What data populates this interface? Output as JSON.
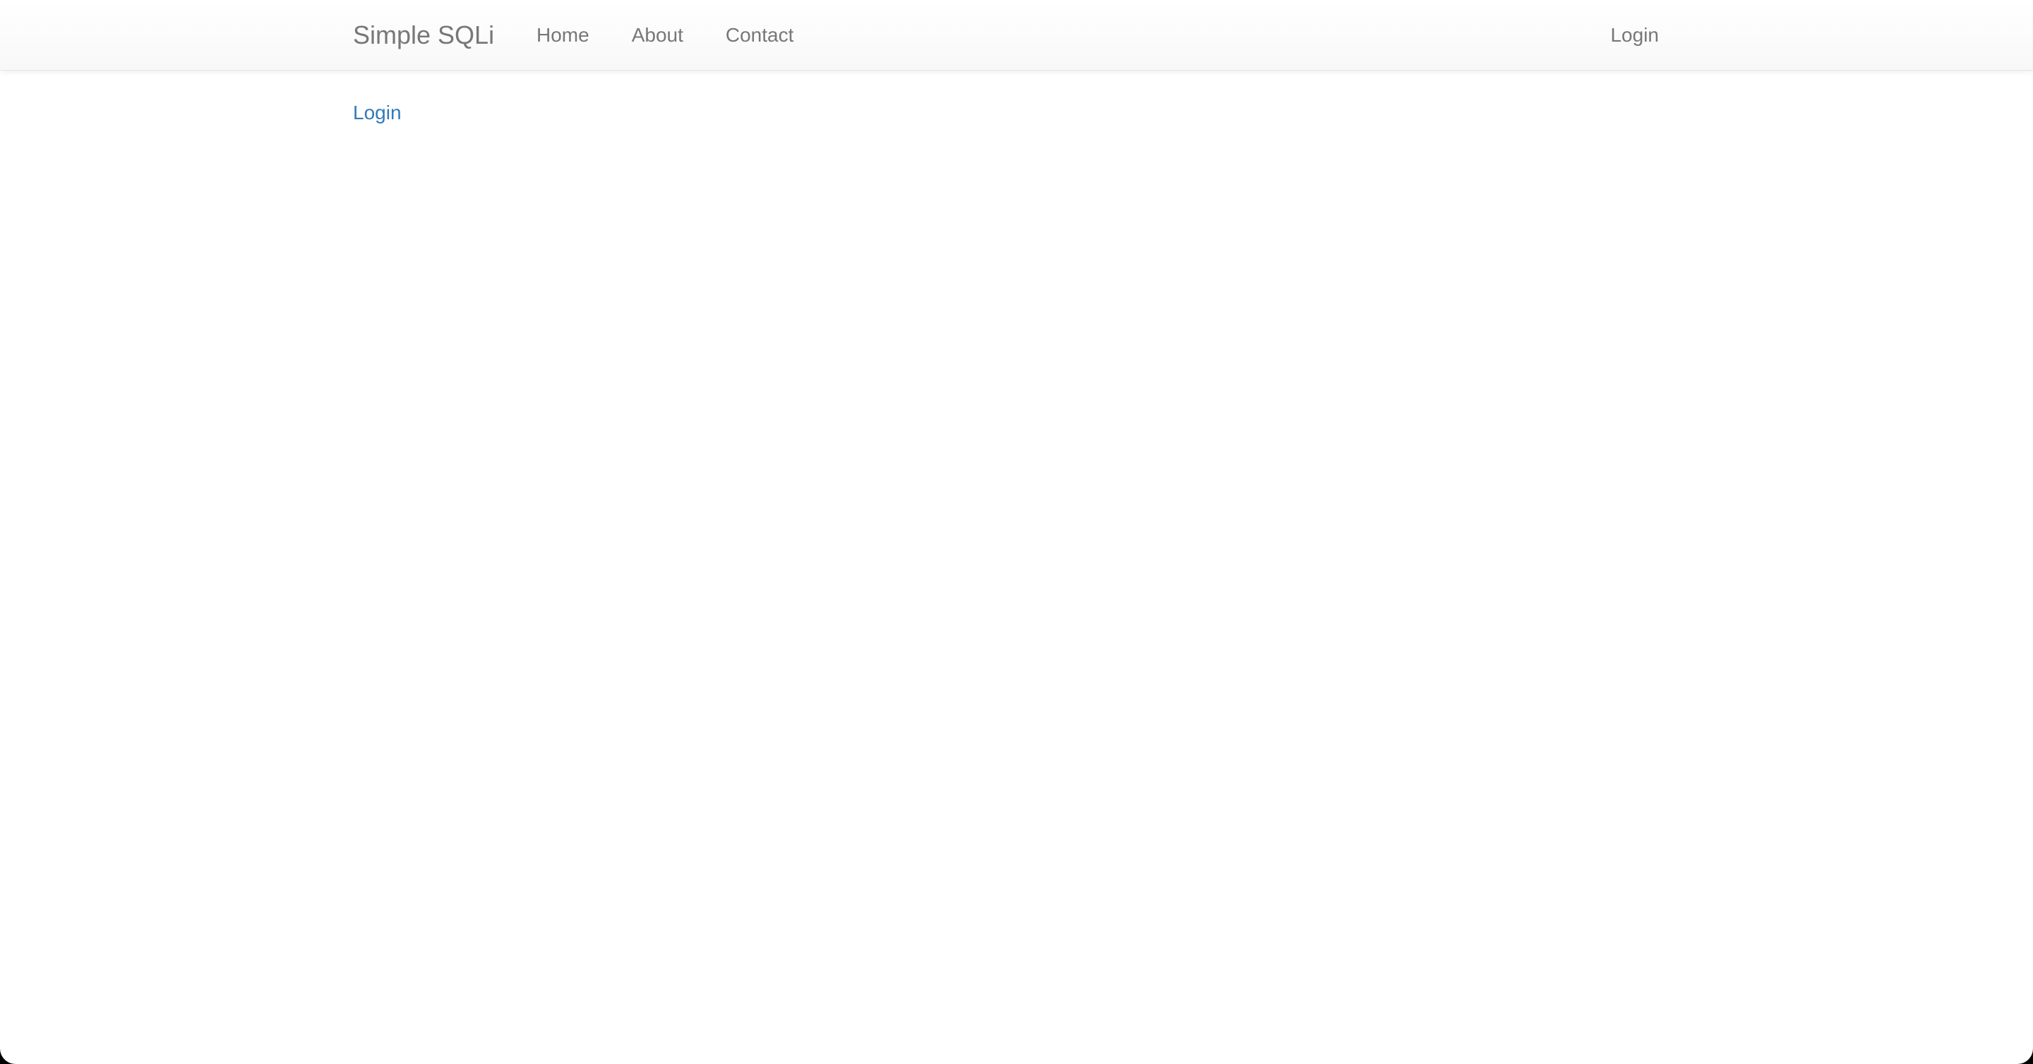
{
  "navbar": {
    "brand": "Simple SQLi",
    "links": [
      {
        "label": "Home"
      },
      {
        "label": "About"
      },
      {
        "label": "Contact"
      }
    ],
    "right_link": "Login"
  },
  "main": {
    "link_label": "Login"
  },
  "colors": {
    "link": "#337ab7",
    "nav_text": "#777777",
    "navbar_bg": "#f8f8f8"
  }
}
